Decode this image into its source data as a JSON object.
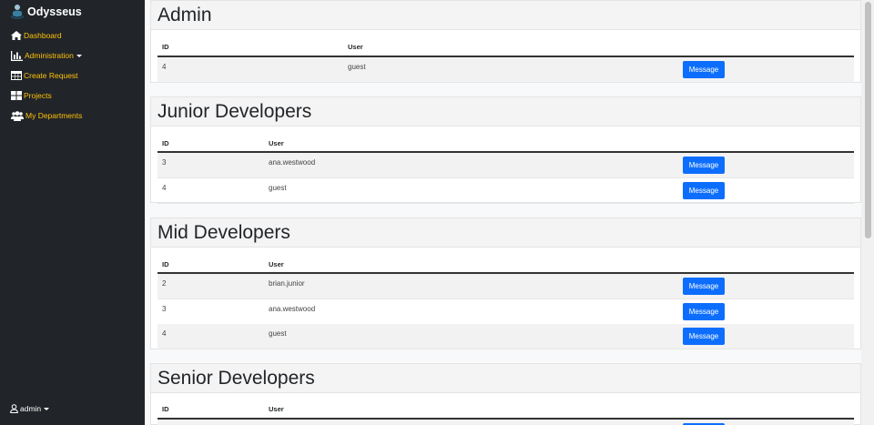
{
  "brand": {
    "name": "Odysseus"
  },
  "sidebar": {
    "items": [
      {
        "label": "Dashboard",
        "icon": "home-icon"
      },
      {
        "label": "Administration",
        "icon": "bar-chart-icon",
        "dropdown": true
      },
      {
        "label": "Create Request",
        "icon": "table-icon"
      },
      {
        "label": "Projects",
        "icon": "grid-icon"
      },
      {
        "label": "My Departments",
        "icon": "users-icon"
      }
    ],
    "user": {
      "label": "admin",
      "icon": "user-icon"
    }
  },
  "columns": {
    "id": "ID",
    "user": "User"
  },
  "departments": [
    {
      "title": "Admin",
      "rows": [
        {
          "id": "4",
          "user": "guest",
          "action": "Message"
        }
      ]
    },
    {
      "title": "Junior Developers",
      "rows": [
        {
          "id": "3",
          "user": "ana.westwood",
          "action": "Message"
        },
        {
          "id": "4",
          "user": "guest",
          "action": "Message"
        }
      ]
    },
    {
      "title": "Mid Developers",
      "rows": [
        {
          "id": "2",
          "user": "brian.junior",
          "action": "Message"
        },
        {
          "id": "3",
          "user": "ana.westwood",
          "action": "Message"
        },
        {
          "id": "4",
          "user": "guest",
          "action": "Message"
        }
      ]
    },
    {
      "title": "Senior Developers",
      "rows": []
    }
  ],
  "colors": {
    "sidebar_bg": "#212529",
    "accent": "#ffc107",
    "button": "#0d6efd"
  }
}
